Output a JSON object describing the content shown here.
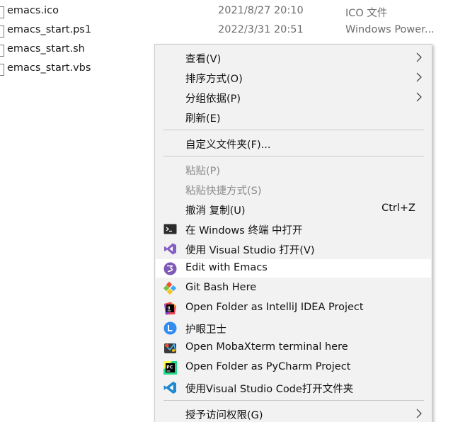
{
  "files": [
    {
      "name": "emacs.ico",
      "date": "2021/8/27 20:10",
      "type": "ICO 文件"
    },
    {
      "name": "emacs_start.ps1",
      "date": "2022/3/31 20:51",
      "type": "Windows Power..."
    },
    {
      "name": "emacs_start.sh",
      "date": "",
      "type": ""
    },
    {
      "name": "emacs_start.vbs",
      "date": "",
      "type": ""
    }
  ],
  "menu": {
    "view": "查看(V)",
    "sort": "排序方式(O)",
    "group": "分组依据(P)",
    "refresh": "刷新(E)",
    "customize": "自定义文件夹(F)...",
    "paste": "粘贴(P)",
    "paste_shortcut": "粘贴快捷方式(S)",
    "undo": "撤消 复制(U)",
    "undo_shortcut": "Ctrl+Z",
    "terminal": "在 Windows 终端 中打开",
    "visual_studio": "使用 Visual Studio 打开(V)",
    "emacs": "Edit with Emacs",
    "git_bash": "Git Bash Here",
    "intellij": "Open Folder as IntelliJ IDEA Project",
    "eye_guard": "护眼卫士",
    "mobaxterm": "Open MobaXterm terminal here",
    "pycharm": "Open Folder as PyCharm Project",
    "vscode": "使用Visual Studio Code打开文件夹",
    "grant_access": "授予访问权限(G)"
  },
  "icons": {
    "terminal": "terminal-icon",
    "visual_studio": "visual-studio-icon",
    "emacs": "emacs-icon",
    "git_bash": "git-icon",
    "intellij": "intellij-icon",
    "eye_guard": "eye-guard-icon",
    "mobaxterm": "mobaxterm-icon",
    "pycharm": "pycharm-icon",
    "vscode": "vscode-icon"
  },
  "colors": {
    "menu_bg": "#f2f2f2",
    "hover_bg": "#ffffff",
    "disabled_text": "#8a8a8a",
    "emacs_purple": "#7e5ab6",
    "vs_purple": "#865fc5",
    "vscode_blue": "#1f8ad2",
    "eye_guard_blue": "#2f8cf0"
  }
}
